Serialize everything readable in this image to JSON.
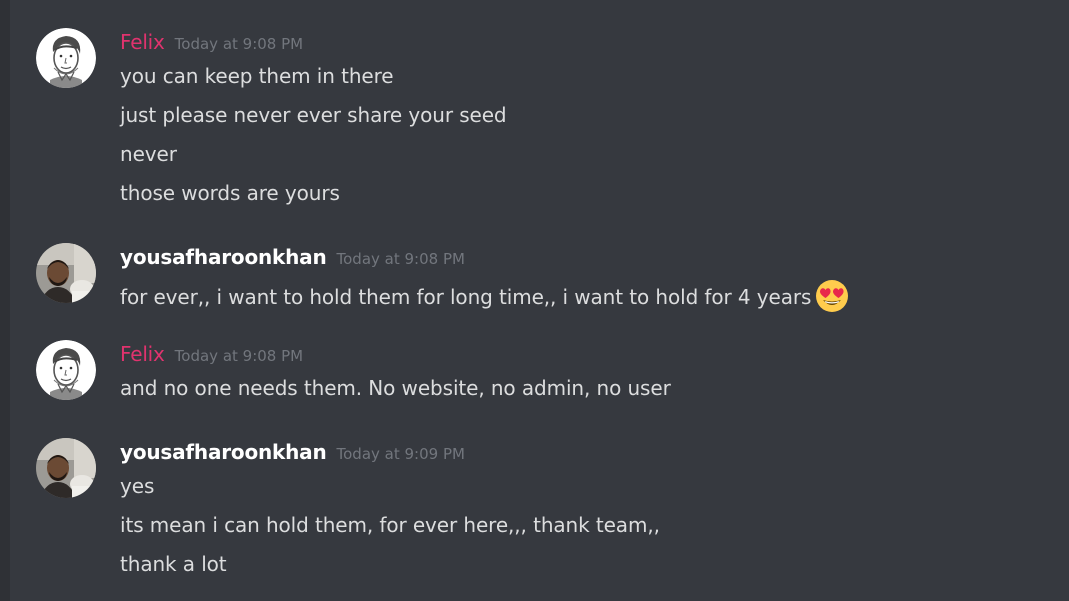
{
  "messages": [
    {
      "author": "Felix",
      "timestamp": "Today at 9:08 PM",
      "lines": [
        "you can keep them in there",
        "just please never ever share your seed",
        "never",
        "those words are yours"
      ]
    },
    {
      "author": "yousafharoonkhan",
      "timestamp": "Today at 9:08 PM",
      "lines": [
        "for ever,, i want to hold them for long time,, i want to hold for 4 years"
      ],
      "emoji": "heart-eyes-emoji"
    },
    {
      "author": "Felix",
      "timestamp": "Today at 9:08 PM",
      "lines": [
        "and no one needs them. No website, no admin, no user"
      ]
    },
    {
      "author": "yousafharoonkhan",
      "timestamp": "Today at 9:09 PM",
      "lines": [
        "yes",
        "its mean i can hold them, for ever here,,, thank team,,",
        "thank a lot"
      ]
    }
  ],
  "colors": {
    "background": "#36393f",
    "felix_name": "#e0336e",
    "other_name": "#ffffff",
    "message_text": "#dcddde",
    "timestamp": "#72767d"
  }
}
